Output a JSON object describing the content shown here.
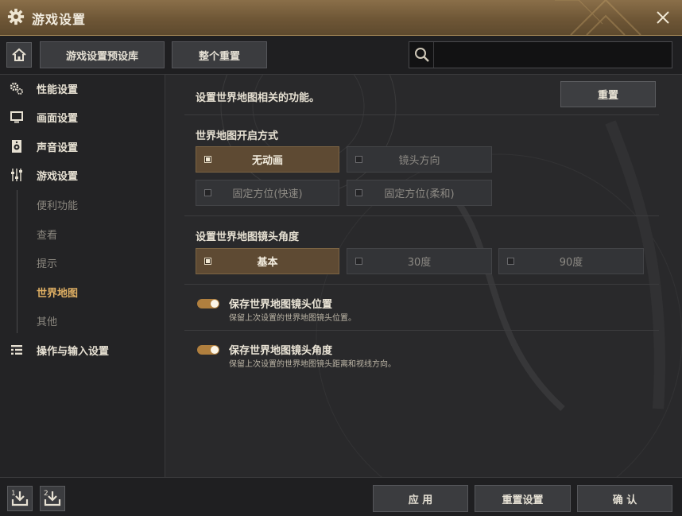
{
  "window": {
    "title": "游戏设置"
  },
  "toolbar": {
    "preset_label": "游戏设置预设库",
    "reset_all_label": "整个重置",
    "search_value": ""
  },
  "sidebar": {
    "items": [
      {
        "label": "性能设置",
        "icon": "gears-icon"
      },
      {
        "label": "画面设置",
        "icon": "monitor-icon"
      },
      {
        "label": "声音设置",
        "icon": "speaker-icon"
      },
      {
        "label": "游戏设置",
        "icon": "sliders-icon"
      },
      {
        "label": "便利功能"
      },
      {
        "label": "查看"
      },
      {
        "label": "提示"
      },
      {
        "label": "世界地图",
        "active": true
      },
      {
        "label": "其他"
      },
      {
        "label": "操作与输入设置",
        "icon": "list-icon"
      }
    ]
  },
  "main": {
    "description": "设置世界地图相关的功能。",
    "reset_label": "重置",
    "open_mode": {
      "heading": "世界地图开启方式",
      "options": [
        "无动画",
        "镜头方向",
        "固定方位(快速)",
        "固定方位(柔和)"
      ],
      "selected": "无动画"
    },
    "camera_angle": {
      "heading": "设置世界地图镜头角度",
      "options": [
        "基本",
        "30度",
        "90度"
      ],
      "selected": "基本"
    },
    "toggles": [
      {
        "title": "保存世界地图镜头位置",
        "desc": "保留上次设置的世界地图镜头位置。",
        "on": true
      },
      {
        "title": "保存世界地图镜头角度",
        "desc": "保留上次设置的世界地图镜头距离和视线方向。",
        "on": true
      }
    ]
  },
  "footer": {
    "slot1_label": "1",
    "slot2_label": "2",
    "apply_label": "应 用",
    "reset_settings_label": "重置设置",
    "confirm_label": "确 认"
  },
  "colors": {
    "accent": "#b07f3e",
    "active_text": "#e0b064",
    "title_bar": "#6e5636"
  }
}
